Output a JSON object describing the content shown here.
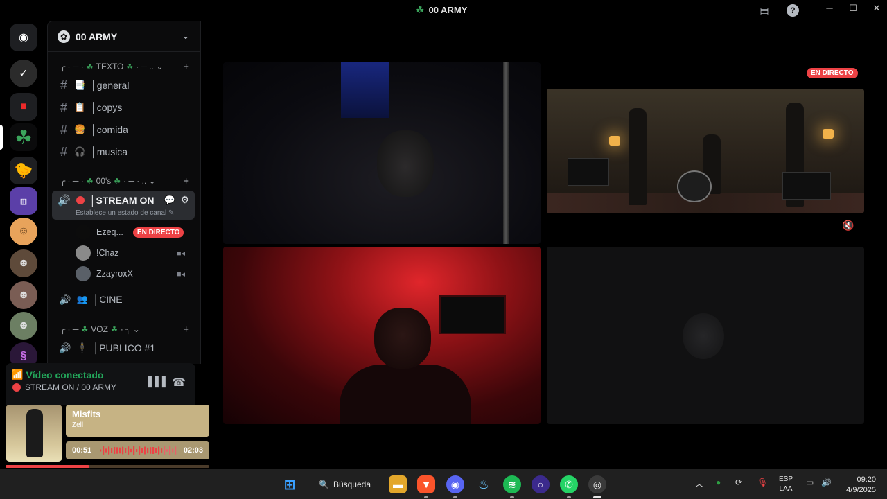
{
  "window": {
    "title": "00 ARMY",
    "controls": [
      "─",
      "☐",
      "✕"
    ]
  },
  "server": {
    "name": "00 ARMY",
    "categories": {
      "texto": "TEXTO",
      "oos": "00's",
      "voz": "VOZ"
    },
    "text_channels": [
      {
        "emoji": "📑",
        "label": "general"
      },
      {
        "emoji": "📋",
        "label": "copys"
      },
      {
        "emoji": "🍔",
        "label": "comida"
      },
      {
        "emoji": "🎧",
        "label": "musica"
      }
    ],
    "active_voice": {
      "label": "STREAM ON",
      "status_hint": "Establece un estado de canal"
    },
    "voice_users": [
      {
        "name": "Ezeq...",
        "badge": "EN DIRECTO"
      },
      {
        "name": "!Chaz"
      },
      {
        "name": "ZzayroxX"
      }
    ],
    "other_voice": [
      {
        "emoji": "👥",
        "label": "CINE"
      },
      {
        "emoji": "🕴",
        "label": "PUBLICO #1"
      }
    ]
  },
  "voice_panel": {
    "status": "Vídeo conectado",
    "channel": "STREAM ON / 00 ARMY"
  },
  "media": {
    "title": "Misfits",
    "artist": "Zell",
    "current_time": "00:51",
    "total_time": "02:03",
    "progress": 0.41
  },
  "stream": {
    "live_label": "EN DIRECTO"
  },
  "taskbar": {
    "search_label": "Búsqueda",
    "lang_line1": "ESP",
    "lang_line2": "LAA",
    "time": "09:20",
    "date": "4/9/2025"
  },
  "colors": {
    "accent_green": "#23a55a",
    "live_red": "#ed4245",
    "media_tint": "#c6b384"
  }
}
